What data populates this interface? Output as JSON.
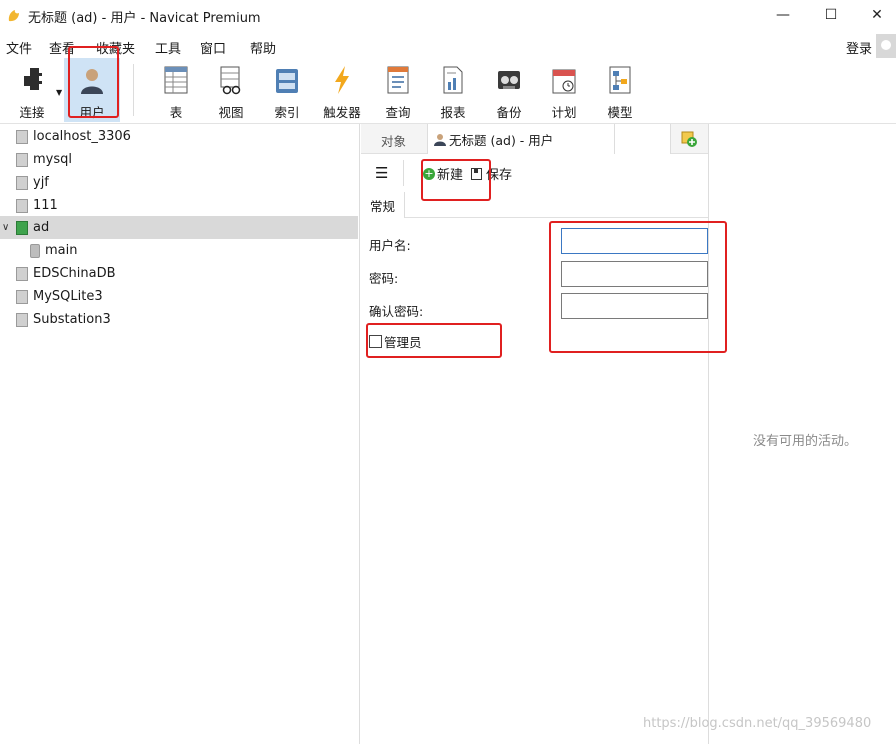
{
  "window": {
    "title": "无标题 (ad) - 用户 - Navicat Premium",
    "min": "—",
    "max": "☐",
    "close": "✕"
  },
  "menu": [
    "文件",
    "查看",
    "收藏夹",
    "工具",
    "窗口",
    "帮助"
  ],
  "account": {
    "login": "登录"
  },
  "toolbar": [
    {
      "label": "连接",
      "icon": "connection-icon"
    },
    {
      "label": "用户",
      "icon": "user-icon",
      "active": true
    },
    {
      "label": "表",
      "icon": "table-icon"
    },
    {
      "label": "视图",
      "icon": "view-icon"
    },
    {
      "label": "索引",
      "icon": "index-icon"
    },
    {
      "label": "触发器",
      "icon": "trigger-icon"
    },
    {
      "label": "查询",
      "icon": "query-icon"
    },
    {
      "label": "报表",
      "icon": "report-icon"
    },
    {
      "label": "备份",
      "icon": "backup-icon"
    },
    {
      "label": "计划",
      "icon": "schedule-icon"
    },
    {
      "label": "模型",
      "icon": "model-icon"
    }
  ],
  "tree": [
    {
      "label": "localhost_3306"
    },
    {
      "label": "mysql"
    },
    {
      "label": "yjf"
    },
    {
      "label": "111"
    },
    {
      "label": "ad",
      "expanded": true,
      "selected": true
    },
    {
      "label": "main"
    },
    {
      "label": "EDSChinaDB"
    },
    {
      "label": "MySQLite3"
    },
    {
      "label": "Substation3"
    }
  ],
  "tabs": {
    "objects": "对象",
    "active": "无标题 (ad) - 用户"
  },
  "editor": {
    "new": "新建",
    "save": "保存",
    "general_tab": "常规",
    "username_label": "用户名:",
    "password_label": "密码:",
    "confirm_label": "确认密码:",
    "admin_label": "管理员"
  },
  "activity": {
    "empty": "没有可用的活动。"
  },
  "watermark": "https://blog.csdn.net/qq_39569480",
  "colors": {
    "annotation": "#e02020",
    "selection": "#d9d9d9",
    "active_tool": "#cfe3f5"
  }
}
